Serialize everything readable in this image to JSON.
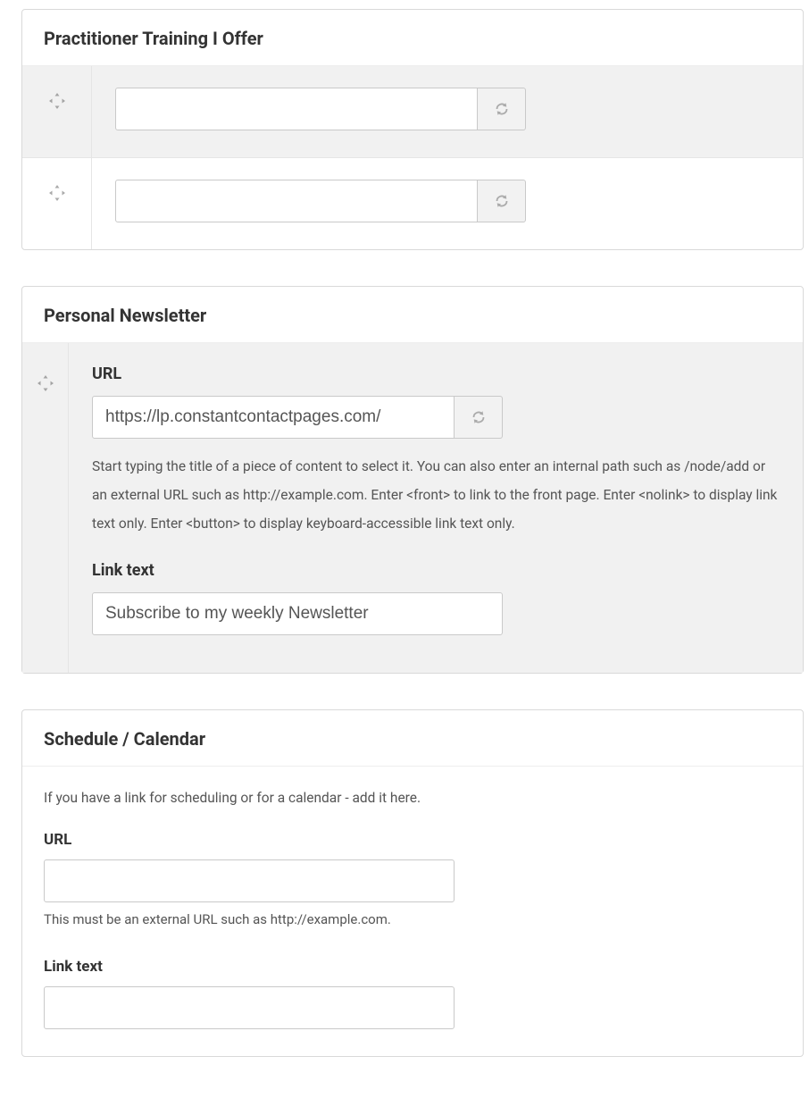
{
  "training": {
    "title": "Practitioner Training I Offer",
    "rows": [
      {
        "value": ""
      },
      {
        "value": ""
      }
    ]
  },
  "newsletter": {
    "title": "Personal Newsletter",
    "url_label": "URL",
    "url_value": "https://lp.constantcontactpages.com/",
    "url_help": "Start typing the title of a piece of content to select it. You can also enter an internal path such as /node/add or an external URL such as http://example.com. Enter <front> to link to the front page. Enter <nolink> to display link text only. Enter <button> to display keyboard-accessible link text only.",
    "linktext_label": "Link text",
    "linktext_value": "Subscribe to my weekly Newsletter"
  },
  "schedule": {
    "title": "Schedule / Calendar",
    "description": "If you have a link for scheduling or for a calendar - add it here.",
    "url_label": "URL",
    "url_value": "",
    "url_help": "This must be an external URL such as http://example.com.",
    "linktext_label": "Link text",
    "linktext_value": ""
  }
}
